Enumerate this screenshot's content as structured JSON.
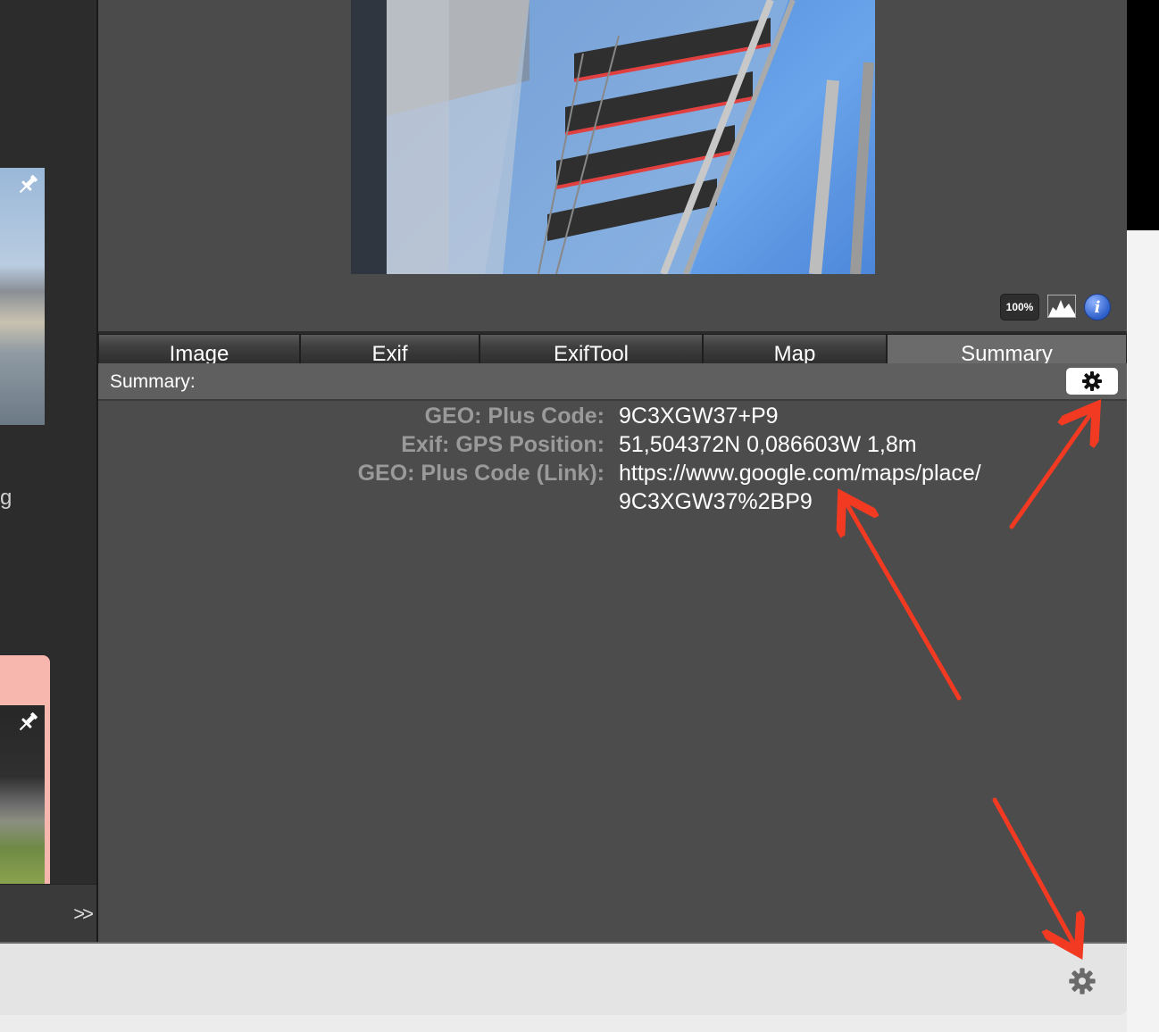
{
  "sidebar": {
    "partial_text_1": "g",
    "expand_label": ">>"
  },
  "preview": {
    "zoom_label": "100%"
  },
  "tabs": [
    {
      "label": "Image"
    },
    {
      "label": "Exif"
    },
    {
      "label": "ExifTool"
    },
    {
      "label": "Map"
    },
    {
      "label": "Summary"
    }
  ],
  "summary": {
    "title": "Summary:",
    "rows": [
      {
        "key": "GEO: Plus Code:",
        "value": "9C3XGW37+P9"
      },
      {
        "key": "Exif: GPS Position:",
        "value": " 51,504372N 0,086603W 1,8m"
      },
      {
        "key": "GEO: Plus Code (Link):",
        "value": "https://www.google.com/maps/place/",
        "value_cont": "9C3XGW37%2BP9"
      }
    ]
  },
  "icons": {
    "summary_settings": "gear-icon",
    "status_settings": "gear-icon",
    "histogram": "histogram-icon",
    "info": "info-icon",
    "pin": "pin-icon"
  },
  "colors": {
    "annotation_arrow": "#f23a22",
    "active_tab": "#6b6b6b",
    "selected_thumb": "#f8b7ae"
  }
}
